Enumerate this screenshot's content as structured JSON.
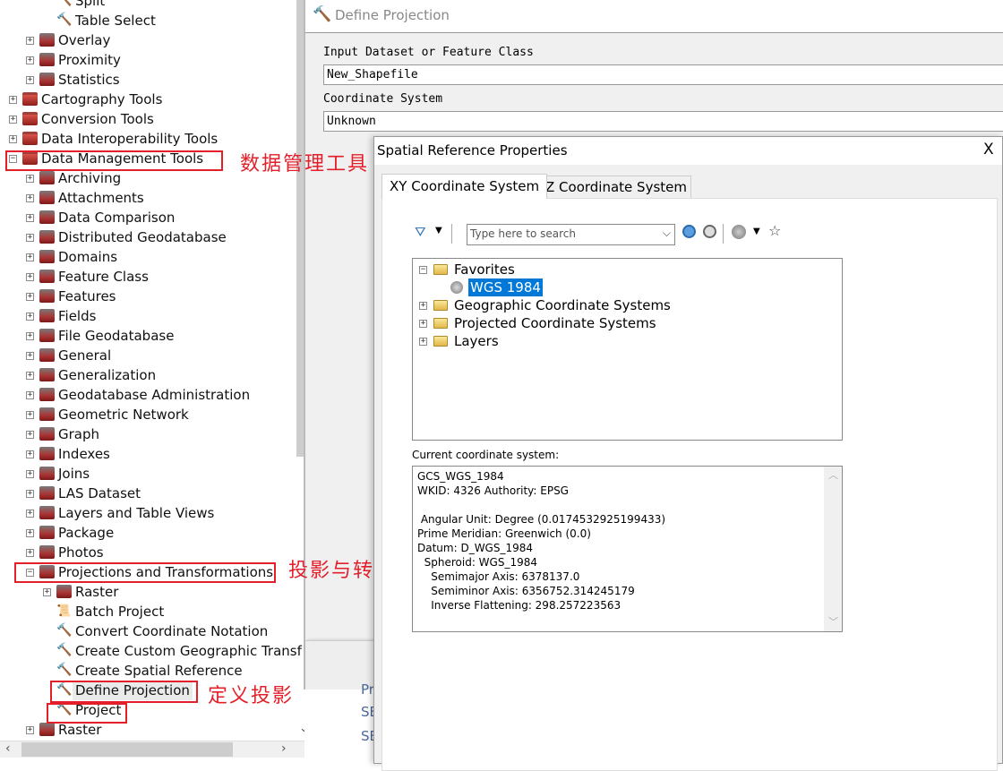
{
  "toolbox_tree": {
    "items": [
      {
        "label": "Split",
        "level": 3,
        "type": "tool"
      },
      {
        "label": "Table Select",
        "level": 3,
        "type": "tool"
      },
      {
        "label": "Overlay",
        "level": 2,
        "type": "toolset",
        "expand": "+"
      },
      {
        "label": "Proximity",
        "level": 2,
        "type": "toolset",
        "expand": "+"
      },
      {
        "label": "Statistics",
        "level": 2,
        "type": "toolset",
        "expand": "+"
      },
      {
        "label": "Cartography Tools",
        "level": 1,
        "type": "toolbox",
        "expand": "+"
      },
      {
        "label": "Conversion Tools",
        "level": 1,
        "type": "toolbox",
        "expand": "+"
      },
      {
        "label": "Data Interoperability Tools",
        "level": 1,
        "type": "toolbox",
        "expand": "+"
      },
      {
        "label": "Data Management Tools",
        "level": 1,
        "type": "toolbox",
        "expand": "-"
      },
      {
        "label": "Archiving",
        "level": 2,
        "type": "toolset",
        "expand": "+"
      },
      {
        "label": "Attachments",
        "level": 2,
        "type": "toolset",
        "expand": "+"
      },
      {
        "label": "Data Comparison",
        "level": 2,
        "type": "toolset",
        "expand": "+"
      },
      {
        "label": "Distributed Geodatabase",
        "level": 2,
        "type": "toolset",
        "expand": "+"
      },
      {
        "label": "Domains",
        "level": 2,
        "type": "toolset",
        "expand": "+"
      },
      {
        "label": "Feature Class",
        "level": 2,
        "type": "toolset",
        "expand": "+"
      },
      {
        "label": "Features",
        "level": 2,
        "type": "toolset",
        "expand": "+"
      },
      {
        "label": "Fields",
        "level": 2,
        "type": "toolset",
        "expand": "+"
      },
      {
        "label": "File Geodatabase",
        "level": 2,
        "type": "toolset",
        "expand": "+"
      },
      {
        "label": "General",
        "level": 2,
        "type": "toolset",
        "expand": "+"
      },
      {
        "label": "Generalization",
        "level": 2,
        "type": "toolset",
        "expand": "+"
      },
      {
        "label": "Geodatabase Administration",
        "level": 2,
        "type": "toolset",
        "expand": "+"
      },
      {
        "label": "Geometric Network",
        "level": 2,
        "type": "toolset",
        "expand": "+"
      },
      {
        "label": "Graph",
        "level": 2,
        "type": "toolset",
        "expand": "+"
      },
      {
        "label": "Indexes",
        "level": 2,
        "type": "toolset",
        "expand": "+"
      },
      {
        "label": "Joins",
        "level": 2,
        "type": "toolset",
        "expand": "+"
      },
      {
        "label": "LAS Dataset",
        "level": 2,
        "type": "toolset",
        "expand": "+"
      },
      {
        "label": "Layers and Table Views",
        "level": 2,
        "type": "toolset",
        "expand": "+"
      },
      {
        "label": "Package",
        "level": 2,
        "type": "toolset",
        "expand": "+"
      },
      {
        "label": "Photos",
        "level": 2,
        "type": "toolset",
        "expand": "+"
      },
      {
        "label": "Projections and Transformations",
        "level": 2,
        "type": "toolset",
        "expand": "-"
      },
      {
        "label": "Raster",
        "level": 3,
        "type": "toolset",
        "expand": "+"
      },
      {
        "label": "Batch Project",
        "level": 3,
        "type": "script"
      },
      {
        "label": "Convert Coordinate Notation",
        "level": 3,
        "type": "tool"
      },
      {
        "label": "Create Custom Geographic Transf",
        "level": 3,
        "type": "tool"
      },
      {
        "label": "Create Spatial Reference",
        "level": 3,
        "type": "tool"
      },
      {
        "label": "Define Projection",
        "level": 3,
        "type": "tool",
        "selected": true
      },
      {
        "label": "Project",
        "level": 3,
        "type": "tool"
      },
      {
        "label": "Raster",
        "level": 2,
        "type": "toolset",
        "expand": "+"
      }
    ]
  },
  "annotations": {
    "data_management": "数据管理工具",
    "projections": "投影与转换",
    "define_projection": "定义投影",
    "highlight_color": "#e3202a"
  },
  "define_projection": {
    "title": "Define Projection",
    "input_label": "Input Dataset or Feature Class",
    "input_value": "New_Shapefile",
    "cs_label": "Coordinate System",
    "cs_value": "Unknown"
  },
  "background_window": {
    "lines": [
      "Pr",
      "SE",
      "SE"
    ]
  },
  "spatial_reference": {
    "title": "Spatial Reference Properties",
    "close": "X",
    "tabs": [
      {
        "label": "XY Coordinate System",
        "active": true
      },
      {
        "label": "Z Coordinate System",
        "active": false
      }
    ],
    "search_placeholder": "Type here to search",
    "tree": [
      {
        "label": "Favorites",
        "expand": "-",
        "icon": "favorites-folder"
      },
      {
        "label": "WGS 1984",
        "icon": "globe",
        "selected": true
      },
      {
        "label": "Geographic Coordinate Systems",
        "expand": "+",
        "icon": "folder"
      },
      {
        "label": "Projected Coordinate Systems",
        "expand": "+",
        "icon": "folder"
      },
      {
        "label": "Layers",
        "expand": "+",
        "icon": "folder"
      }
    ],
    "current_label": "Current coordinate system:",
    "current_lines": [
      "GCS_WGS_1984",
      "WKID: 4326 Authority: EPSG",
      "",
      " Angular Unit: Degree (0.0174532925199433)",
      "Prime Meridian: Greenwich (0.0)",
      "Datum: D_WGS_1984",
      "  Spheroid: WGS_1984",
      "    Semimajor Axis: 6378137.0",
      "    Semiminor Axis: 6356752.314245179",
      "    Inverse Flattening: 298.257223563"
    ],
    "selection_color": "#0078d7"
  }
}
